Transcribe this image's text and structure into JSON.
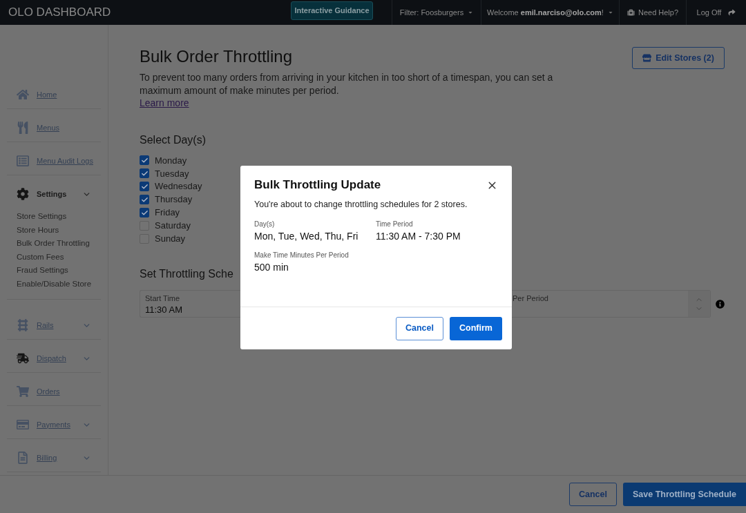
{
  "header": {
    "title": "OLO DASHBOARD",
    "guidance_button": "Interactive Guidance",
    "filter": "Filter: Foosburgers",
    "welcome": "Welcome **emil.narciso@olo.com**!",
    "help": "Need Help?",
    "logoff": "Log Off"
  },
  "sidebar": {
    "items": [
      {
        "label": "Home",
        "selected": false,
        "expandable": false
      },
      {
        "label": "Menus",
        "selected": false,
        "expandable": false
      },
      {
        "label": "Menu Audit Logs",
        "selected": false,
        "expandable": false
      },
      {
        "label": "Settings",
        "selected": true,
        "expandable": true,
        "children": [
          {
            "label": "Store Settings"
          },
          {
            "label": "Store Hours"
          },
          {
            "label": "Bulk Order Throttling"
          },
          {
            "label": "Custom Fees"
          },
          {
            "label": "Fraud Settings"
          },
          {
            "label": "Enable/Disable Store"
          }
        ]
      },
      {
        "label": "Rails",
        "selected": false,
        "expandable": true
      },
      {
        "label": "Dispatch",
        "selected": false,
        "expandable": true
      },
      {
        "label": "Orders",
        "selected": false,
        "expandable": false
      },
      {
        "label": "Payments",
        "selected": false,
        "expandable": true
      },
      {
        "label": "Billing",
        "selected": false,
        "expandable": true
      }
    ]
  },
  "page": {
    "title": "Bulk Order Throttling",
    "description": "To prevent too many orders from arriving in your kitchen in too short of a timespan, you can set a maximum amount of make minutes per period.",
    "learn_more": "Learn more",
    "edit_stores_button": "Edit Stores (2)",
    "days_heading": "Select Day(s)",
    "days": [
      {
        "label": "Monday",
        "checked": true
      },
      {
        "label": "Tuesday",
        "checked": true
      },
      {
        "label": "Wednesday",
        "checked": true
      },
      {
        "label": "Thursday",
        "checked": true
      },
      {
        "label": "Friday",
        "checked": true
      },
      {
        "label": "Saturday",
        "checked": false
      },
      {
        "label": "Sunday",
        "checked": false
      }
    ],
    "schedule_heading": "Set Throttling Sche",
    "fields": [
      {
        "kind": "time",
        "label": "Start Time",
        "value": "11:30 AM"
      },
      {
        "kind": "stepper",
        "label": "Per Period"
      }
    ]
  },
  "footer": {
    "buttons": [
      {
        "label": "Cancel",
        "kind": "secondary"
      },
      {
        "label": "Save Throttling Schedule",
        "kind": "primary"
      }
    ]
  },
  "modal": {
    "title": "Bulk Throttling Update",
    "message": "You're about to change throttling schedules for 2 stores.",
    "details": [
      {
        "label": "Day(s)",
        "value": "Mon, Tue, Wed, Thu, Fri"
      },
      {
        "label": "Time Period",
        "value": "11:30 AM - 7:30 PM"
      },
      {
        "label": "Make Time Minutes Per Period",
        "value": "500 min"
      }
    ],
    "buttons": [
      {
        "label": "Cancel",
        "kind": "secondary"
      },
      {
        "label": "Confirm",
        "kind": "primary"
      }
    ]
  }
}
